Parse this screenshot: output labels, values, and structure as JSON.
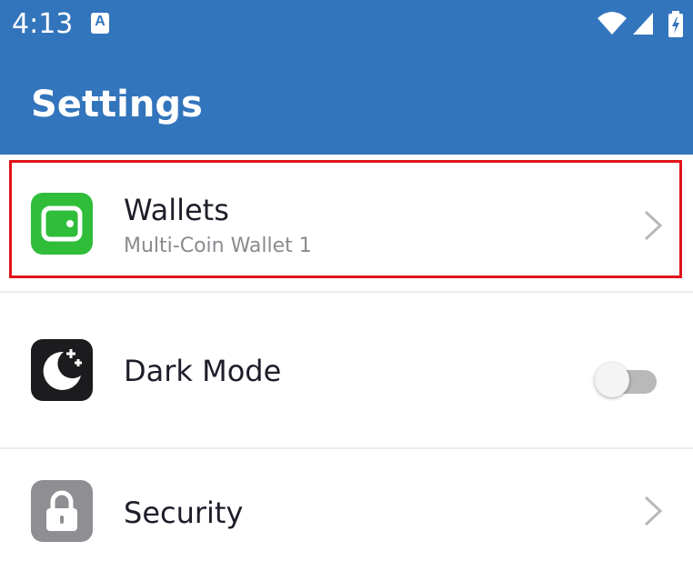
{
  "status_bar": {
    "time": "4:13",
    "notification_icon": "A",
    "icons": [
      "wifi-icon",
      "cellular-signal-icon",
      "battery-charging-icon"
    ]
  },
  "header": {
    "title": "Settings"
  },
  "colors": {
    "appbar": "#3375bc",
    "wallet_tile": "#2fbd3a",
    "dark_tile": "#1c1c1e",
    "security_tile": "#8e8e93",
    "highlight": "#e0141a"
  },
  "settings": {
    "wallets": {
      "label": "Wallets",
      "subtitle": "Multi-Coin Wallet 1",
      "icon": "wallet-icon"
    },
    "dark_mode": {
      "label": "Dark Mode",
      "icon": "moon-stars-icon",
      "enabled": false
    },
    "security": {
      "label": "Security",
      "icon": "lock-icon"
    }
  }
}
